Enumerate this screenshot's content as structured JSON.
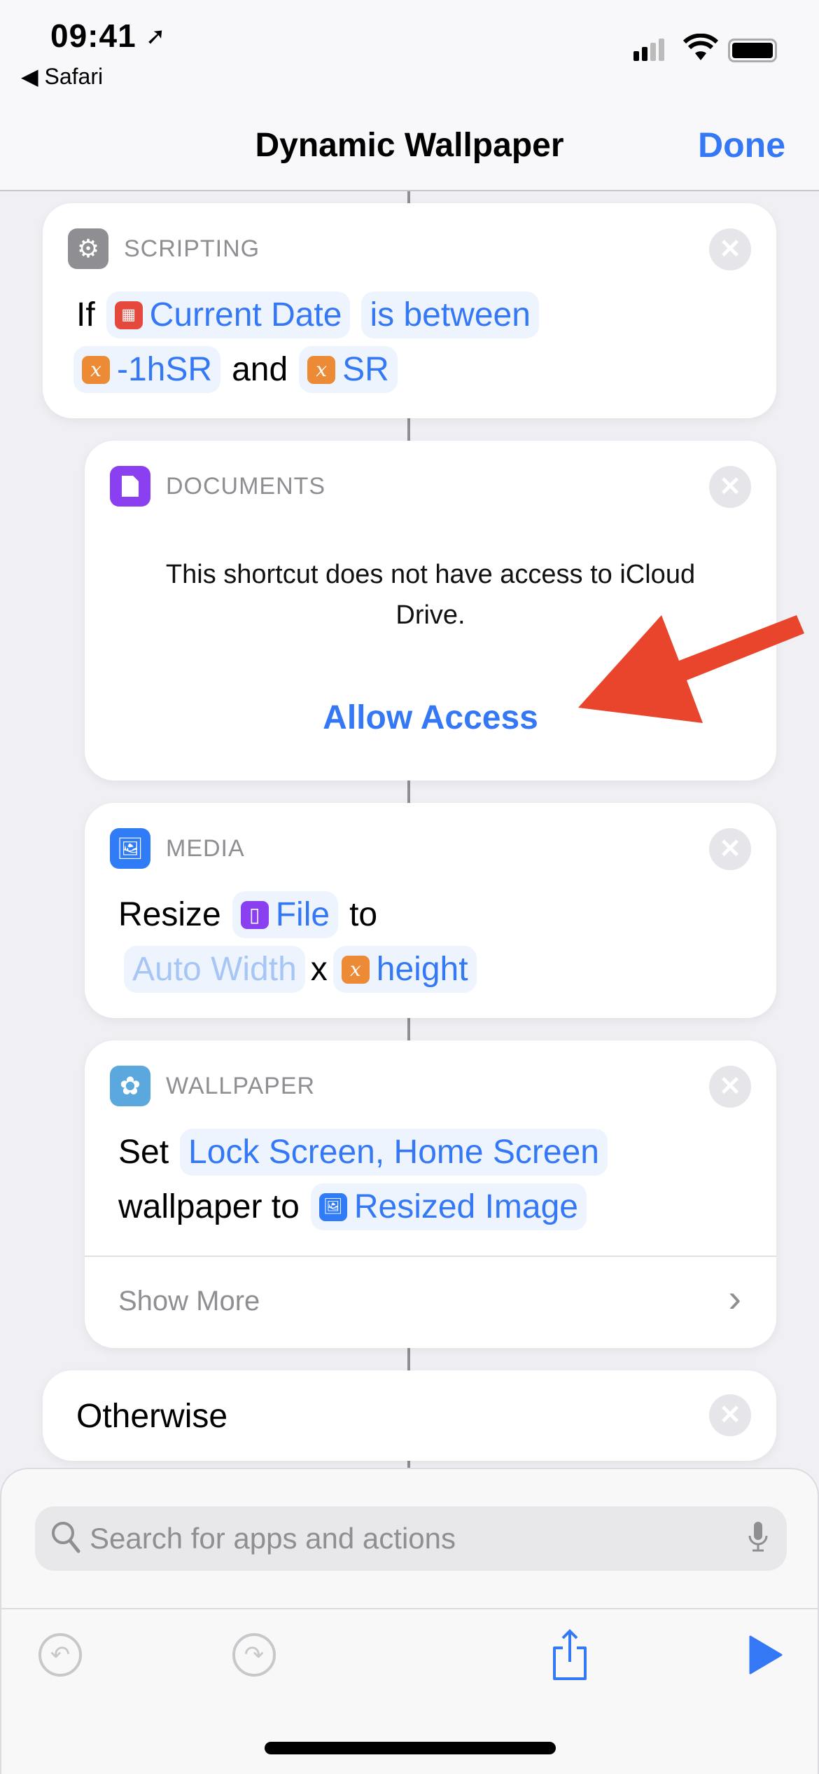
{
  "status_bar": {
    "time": "09:41",
    "back_app": "Safari"
  },
  "nav": {
    "title": "Dynamic Wallpaper",
    "done_label": "Done"
  },
  "actions": [
    {
      "category": "SCRIPTING",
      "icon": "gear-icon",
      "icon_color": "#8e8e93",
      "line1": {
        "prefix": "If",
        "var1": "Current Date",
        "op": "is between"
      },
      "line2": {
        "var1": "-1hSR",
        "joiner": "and",
        "var2": "SR"
      }
    },
    {
      "category": "DOCUMENTS",
      "icon": "document-icon",
      "icon_color": "#8a3ff0",
      "message": "This shortcut does not have access to iCloud Drive.",
      "button": "Allow Access"
    },
    {
      "category": "MEDIA",
      "icon": "photos-icon",
      "icon_color": "#2f7cf6",
      "line1": {
        "prefix": "Resize",
        "var": "File",
        "suffix": "to"
      },
      "line2": {
        "width": "Auto Width",
        "x": "x",
        "height": "height"
      }
    },
    {
      "category": "WALLPAPER",
      "icon": "flower-icon",
      "icon_color": "#5aa8dd",
      "line1": {
        "prefix": "Set",
        "value": "Lock Screen, Home Screen"
      },
      "line2": {
        "prefix": "wallpaper to",
        "var": "Resized Image"
      },
      "show_more": "Show More"
    },
    {
      "label": "Otherwise"
    }
  ],
  "search": {
    "placeholder": "Search for apps and actions"
  },
  "colors": {
    "accent": "#3478f6",
    "variable": "#ec8a35",
    "calendar": "#e5483c",
    "annotation_arrow": "#e8452c"
  }
}
